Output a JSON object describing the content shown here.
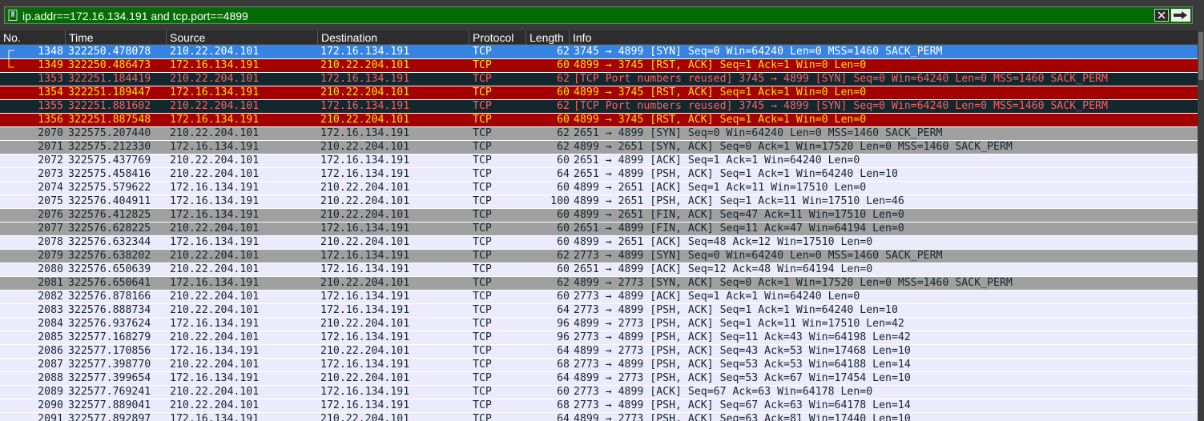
{
  "filter": {
    "value": "ip.addr==172.16.134.191 and tcp.port==4899",
    "color": "#056c05"
  },
  "columns": [
    "No.",
    "Time",
    "Source",
    "Destination",
    "Protocol",
    "Length",
    "Info"
  ],
  "colors": {
    "selected": "#3584e4",
    "rst": "#a40000",
    "reused": "#12272e",
    "syn_fin": "#a0a0a0",
    "normal": "#ecebfb"
  },
  "packets": [
    {
      "no": "1348",
      "time": "322250.478078",
      "src": "210.22.204.101",
      "dst": "172.16.134.191",
      "proto": "TCP",
      "len": "62",
      "info": "3745 → 4899 [SYN] Seq=0 Win=64240 Len=0 MSS=1460 SACK_PERM",
      "style": "selected",
      "marker": "first"
    },
    {
      "no": "1349",
      "time": "322250.486473",
      "src": "172.16.134.191",
      "dst": "210.22.204.101",
      "proto": "TCP",
      "len": "60",
      "info": "4899 → 3745 [RST, ACK] Seq=1 Ack=1 Win=0 Len=0",
      "style": "rst",
      "marker": "last"
    },
    {
      "no": "1353",
      "time": "322251.184419",
      "src": "210.22.204.101",
      "dst": "172.16.134.191",
      "proto": "TCP",
      "len": "62",
      "info": "[TCP Port numbers reused] 3745 → 4899 [SYN] Seq=0 Win=64240 Len=0 MSS=1460 SACK_PERM",
      "style": "reused"
    },
    {
      "no": "1354",
      "time": "322251.189447",
      "src": "172.16.134.191",
      "dst": "210.22.204.101",
      "proto": "TCP",
      "len": "60",
      "info": "4899 → 3745 [RST, ACK] Seq=1 Ack=1 Win=0 Len=0",
      "style": "rst"
    },
    {
      "no": "1355",
      "time": "322251.881602",
      "src": "210.22.204.101",
      "dst": "172.16.134.191",
      "proto": "TCP",
      "len": "62",
      "info": "[TCP Port numbers reused] 3745 → 4899 [SYN] Seq=0 Win=64240 Len=0 MSS=1460 SACK_PERM",
      "style": "reused"
    },
    {
      "no": "1356",
      "time": "322251.887548",
      "src": "172.16.134.191",
      "dst": "210.22.204.101",
      "proto": "TCP",
      "len": "60",
      "info": "4899 → 3745 [RST, ACK] Seq=1 Ack=1 Win=0 Len=0",
      "style": "rst"
    },
    {
      "no": "2070",
      "time": "322575.207440",
      "src": "210.22.204.101",
      "dst": "172.16.134.191",
      "proto": "TCP",
      "len": "62",
      "info": "2651 → 4899 [SYN] Seq=0 Win=64240 Len=0 MSS=1460 SACK_PERM",
      "style": "syn_fin"
    },
    {
      "no": "2071",
      "time": "322575.212330",
      "src": "172.16.134.191",
      "dst": "210.22.204.101",
      "proto": "TCP",
      "len": "62",
      "info": "4899 → 2651 [SYN, ACK] Seq=0 Ack=1 Win=17520 Len=0 MSS=1460 SACK_PERM",
      "style": "syn_fin"
    },
    {
      "no": "2072",
      "time": "322575.437769",
      "src": "210.22.204.101",
      "dst": "172.16.134.191",
      "proto": "TCP",
      "len": "60",
      "info": "2651 → 4899 [ACK] Seq=1 Ack=1 Win=64240 Len=0",
      "style": "normal"
    },
    {
      "no": "2073",
      "time": "322575.458416",
      "src": "210.22.204.101",
      "dst": "172.16.134.191",
      "proto": "TCP",
      "len": "64",
      "info": "2651 → 4899 [PSH, ACK] Seq=1 Ack=1 Win=64240 Len=10",
      "style": "normal"
    },
    {
      "no": "2074",
      "time": "322575.579622",
      "src": "172.16.134.191",
      "dst": "210.22.204.101",
      "proto": "TCP",
      "len": "60",
      "info": "4899 → 2651 [ACK] Seq=1 Ack=11 Win=17510 Len=0",
      "style": "normal"
    },
    {
      "no": "2075",
      "time": "322576.404911",
      "src": "172.16.134.191",
      "dst": "210.22.204.101",
      "proto": "TCP",
      "len": "100",
      "info": "4899 → 2651 [PSH, ACK] Seq=1 Ack=11 Win=17510 Len=46",
      "style": "normal"
    },
    {
      "no": "2076",
      "time": "322576.412825",
      "src": "172.16.134.191",
      "dst": "210.22.204.101",
      "proto": "TCP",
      "len": "60",
      "info": "4899 → 2651 [FIN, ACK] Seq=47 Ack=11 Win=17510 Len=0",
      "style": "syn_fin"
    },
    {
      "no": "2077",
      "time": "322576.628225",
      "src": "210.22.204.101",
      "dst": "172.16.134.191",
      "proto": "TCP",
      "len": "60",
      "info": "2651 → 4899 [FIN, ACK] Seq=11 Ack=47 Win=64194 Len=0",
      "style": "syn_fin"
    },
    {
      "no": "2078",
      "time": "322576.632344",
      "src": "172.16.134.191",
      "dst": "210.22.204.101",
      "proto": "TCP",
      "len": "60",
      "info": "4899 → 2651 [ACK] Seq=48 Ack=12 Win=17510 Len=0",
      "style": "normal"
    },
    {
      "no": "2079",
      "time": "322576.638202",
      "src": "210.22.204.101",
      "dst": "172.16.134.191",
      "proto": "TCP",
      "len": "62",
      "info": "2773 → 4899 [SYN] Seq=0 Win=64240 Len=0 MSS=1460 SACK_PERM",
      "style": "syn_fin"
    },
    {
      "no": "2080",
      "time": "322576.650639",
      "src": "210.22.204.101",
      "dst": "172.16.134.191",
      "proto": "TCP",
      "len": "60",
      "info": "2651 → 4899 [ACK] Seq=12 Ack=48 Win=64194 Len=0",
      "style": "normal"
    },
    {
      "no": "2081",
      "time": "322576.650641",
      "src": "172.16.134.191",
      "dst": "210.22.204.101",
      "proto": "TCP",
      "len": "62",
      "info": "4899 → 2773 [SYN, ACK] Seq=0 Ack=1 Win=17520 Len=0 MSS=1460 SACK_PERM",
      "style": "syn_fin"
    },
    {
      "no": "2082",
      "time": "322576.878166",
      "src": "210.22.204.101",
      "dst": "172.16.134.191",
      "proto": "TCP",
      "len": "60",
      "info": "2773 → 4899 [ACK] Seq=1 Ack=1 Win=64240 Len=0",
      "style": "normal"
    },
    {
      "no": "2083",
      "time": "322576.888734",
      "src": "210.22.204.101",
      "dst": "172.16.134.191",
      "proto": "TCP",
      "len": "64",
      "info": "2773 → 4899 [PSH, ACK] Seq=1 Ack=1 Win=64240 Len=10",
      "style": "normal"
    },
    {
      "no": "2084",
      "time": "322576.937624",
      "src": "172.16.134.191",
      "dst": "210.22.204.101",
      "proto": "TCP",
      "len": "96",
      "info": "4899 → 2773 [PSH, ACK] Seq=1 Ack=11 Win=17510 Len=42",
      "style": "normal"
    },
    {
      "no": "2085",
      "time": "322577.168279",
      "src": "210.22.204.101",
      "dst": "172.16.134.191",
      "proto": "TCP",
      "len": "96",
      "info": "2773 → 4899 [PSH, ACK] Seq=11 Ack=43 Win=64198 Len=42",
      "style": "normal"
    },
    {
      "no": "2086",
      "time": "322577.170856",
      "src": "172.16.134.191",
      "dst": "210.22.204.101",
      "proto": "TCP",
      "len": "64",
      "info": "4899 → 2773 [PSH, ACK] Seq=43 Ack=53 Win=17468 Len=10",
      "style": "normal"
    },
    {
      "no": "2087",
      "time": "322577.398770",
      "src": "210.22.204.101",
      "dst": "172.16.134.191",
      "proto": "TCP",
      "len": "68",
      "info": "2773 → 4899 [PSH, ACK] Seq=53 Ack=53 Win=64188 Len=14",
      "style": "normal"
    },
    {
      "no": "2088",
      "time": "322577.399654",
      "src": "172.16.134.191",
      "dst": "210.22.204.101",
      "proto": "TCP",
      "len": "64",
      "info": "4899 → 2773 [PSH, ACK] Seq=53 Ack=67 Win=17454 Len=10",
      "style": "normal"
    },
    {
      "no": "2089",
      "time": "322577.769241",
      "src": "210.22.204.101",
      "dst": "172.16.134.191",
      "proto": "TCP",
      "len": "60",
      "info": "2773 → 4899 [ACK] Seq=67 Ack=63 Win=64178 Len=0",
      "style": "normal"
    },
    {
      "no": "2090",
      "time": "322577.889041",
      "src": "210.22.204.101",
      "dst": "172.16.134.191",
      "proto": "TCP",
      "len": "68",
      "info": "2773 → 4899 [PSH, ACK] Seq=67 Ack=63 Win=64178 Len=14",
      "style": "normal"
    },
    {
      "no": "2091",
      "time": "322577.892897",
      "src": "172.16.134.191",
      "dst": "210.22.204.101",
      "proto": "TCP",
      "len": "64",
      "info": "4899 → 2773 [PSH, ACK] Seq=63 Ack=81 Win=17440 Len=10",
      "style": "normal"
    }
  ]
}
